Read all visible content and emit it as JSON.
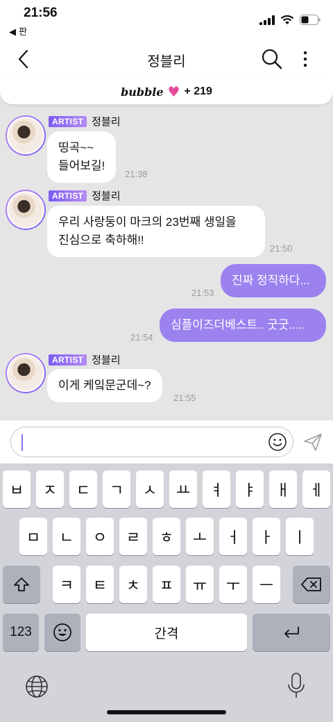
{
  "status_bar": {
    "time": "21:56",
    "back_app": "◀ 판"
  },
  "navbar": {
    "title": "정블리"
  },
  "banner": {
    "brand": "bubble",
    "heart": "♥",
    "count": "+ 219"
  },
  "messages": [
    {
      "type": "incoming",
      "badge": "ARTIST",
      "sender": "정블리",
      "lines": [
        "띵곡~~",
        "들어보길!"
      ],
      "time": "21:38"
    },
    {
      "type": "incoming",
      "badge": "ARTIST",
      "sender": "정블리",
      "lines": [
        "우리 사랑둥이 마크의 23번째 생일을",
        "진심으로 축하해!!"
      ],
      "time": "21:50"
    },
    {
      "type": "outgoing",
      "text": "진짜 정직하다...",
      "time": "21:53"
    },
    {
      "type": "outgoing",
      "text": "심플이즈더베스트.. 굿굿.....",
      "time": "21:54"
    },
    {
      "type": "incoming",
      "badge": "ARTIST",
      "sender": "정블리",
      "lines": [
        "이게 케잌문군데~?"
      ],
      "time": "21:55"
    }
  ],
  "input": {
    "value": ""
  },
  "keyboard": {
    "row1": [
      "ㅂ",
      "ㅈ",
      "ㄷ",
      "ㄱ",
      "ㅅ",
      "ㅛ",
      "ㅕ",
      "ㅑ",
      "ㅐ",
      "ㅔ"
    ],
    "row2": [
      "ㅁ",
      "ㄴ",
      "ㅇ",
      "ㄹ",
      "ㅎ",
      "ㅗ",
      "ㅓ",
      "ㅏ",
      "ㅣ"
    ],
    "row3": [
      "ㅋ",
      "ㅌ",
      "ㅊ",
      "ㅍ",
      "ㅠ",
      "ㅜ",
      "ㅡ"
    ],
    "numbers_label": "123",
    "space_label": "간격"
  },
  "colors": {
    "accent": "#9b82ef",
    "badge_start": "#7c5cf0",
    "badge_end": "#b48cf4",
    "heart": "#e44c9a"
  },
  "icons": [
    "chevron-left-icon",
    "search-icon",
    "more-vertical-icon",
    "smiley-icon",
    "send-icon",
    "shift-icon",
    "backspace-icon",
    "emoji-icon",
    "return-icon",
    "globe-icon",
    "microphone-icon"
  ]
}
